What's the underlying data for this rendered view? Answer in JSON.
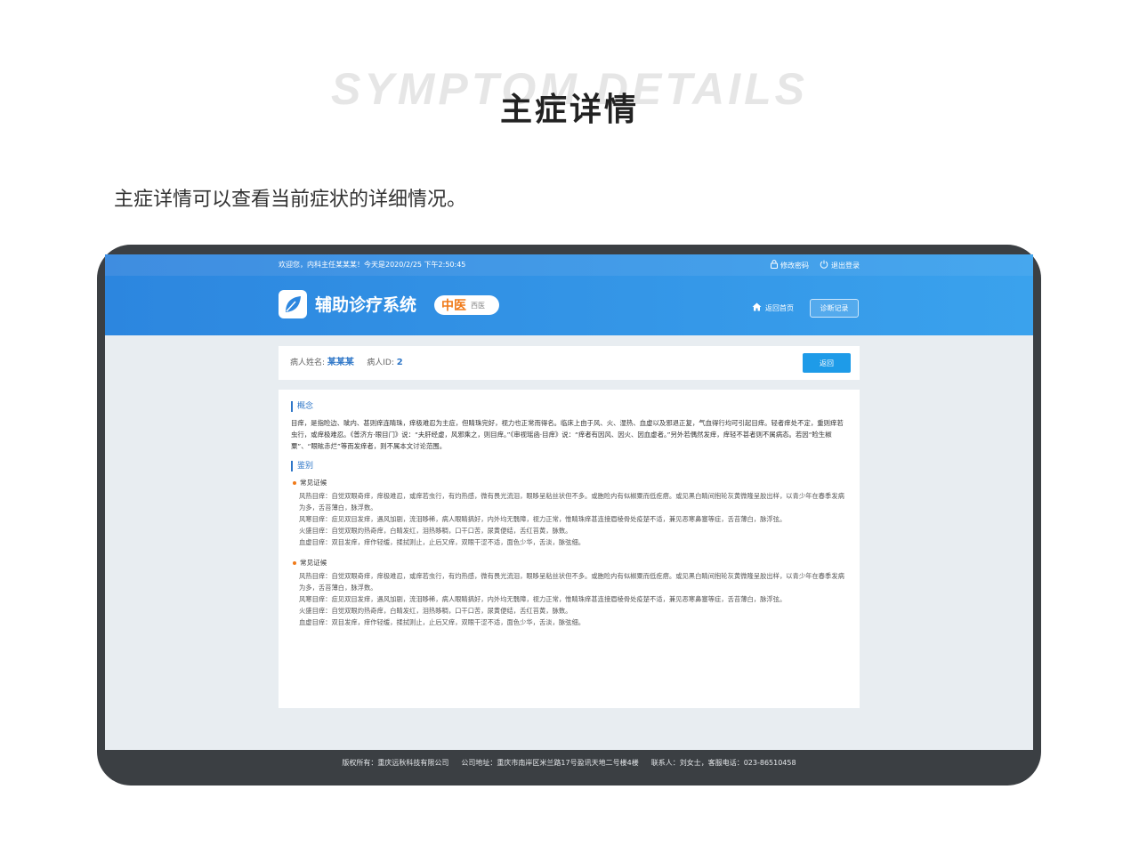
{
  "page": {
    "bg_title": "SYMPTOM DETAILS",
    "title": "主症详情",
    "intro": "主症详情可以查看当前症状的详细情况。"
  },
  "topbar": {
    "welcome": "欢迎您，内科主任某某某！今天是2020/2/25 下午2:50:45",
    "change_password": "修改密码",
    "logout": "退出登录"
  },
  "header": {
    "system_name": "辅助诊疗系统",
    "mode_active": "中医",
    "mode_other": "西医",
    "home": "返回首页",
    "records": "诊断记录"
  },
  "patient": {
    "name_label": "病人姓名:",
    "name": "某某某",
    "id_label": "病人ID:",
    "id": "2",
    "back": "返回"
  },
  "content": {
    "concept_title": "概念",
    "concept_text": "目痒，是指睑边、眦内、甚则痒连睛珠，痒极难忍为主症，但睛珠完好，视力也正常而得名。临床上由于风、火、湿热、血虚以及邪退正复，气血得行均可引起目痒。轻者痒处不定，重则痒若虫行，或痒极难忍。《普济方·眼目门》说：“夫肝经虚，风邪乘之，则目痒。”《审视瑶函·目痒》说：“痒者有因风、因火、因血虚者。”另外若偶然发痒，痒轻不甚者则不属病态。若因“睑生椒粟”、“眼眩赤烂”等而发痒者，则不属本文讨论范围。",
    "diff_title": "鉴别",
    "groups": [
      {
        "title": "常见证候",
        "lines": [
          "风热目痒：自觉双眼奇痒，痒极难忍，或痒若虫行，有灼热感，微有畏光流泪，眼眵呈粘丝状但不多。或胞睑内有似椒粟而低疙瘩。或见黑白睛间抱轮灰黄微隆呈胶出样，以青少年在春季发病为多，舌苔薄白，脉浮数。",
          "风寒目痒：症见双目发痒，遇风加剧，流泪眵稀，病人眼睛搞好，内外均无翳障，视力正常，惟睛珠痒甚连接眉棱骨处疫楚不适，兼见恶寒鼻塞等症，舌苔薄白，脉浮弦。",
          "火盛目痒：自觉双眼灼热奇痒，白睛发红，泪热眵稠，口干口苦，尿黄便结，舌红苔黄，脉数。",
          "血虚目痒：双目发痒，痒作轻缓，揉拭则止，止后又痒，双眼干涩不适，面色少华，舌淡，脉弦细。"
        ]
      },
      {
        "title": "常见证候",
        "lines": [
          "风热目痒：自觉双眼奇痒，痒极难忍，或痒若虫行，有灼热感，微有畏光流泪，眼眵呈粘丝状但不多。或胞睑内有似椒粟而低疙瘩。或见黑白睛间抱轮灰黄微隆呈胶出样，以青少年在春季发病为多，舌苔薄白，脉浮数。",
          "风寒目痒：症见双目发痒，遇风加剧，流泪眵稀，病人眼睛搞好，内外均无翳障，视力正常，惟睛珠痒甚连接眉棱骨处疫楚不适，兼见恶寒鼻塞等症，舌苔薄白，脉浮弦。",
          "火盛目痒：自觉双眼灼热奇痒，白睛发红，泪热眵稠，口干口苦，尿黄便结，舌红苔黄，脉数。",
          "血虚目痒：双目发痒，痒作轻缓，揉拭则止，止后又痒，双眼干涩不适，面色少华，舌淡，脉弦细。"
        ]
      }
    ]
  },
  "footer": {
    "copyright": "版权所有：重庆远秋科技有限公司",
    "address": "公司地址：重庆市南岸区米兰路17号盈讯天地二号楼4楼",
    "contact": "联系人：刘女士，客服电话：023-86510458"
  },
  "colors": {
    "accent": "#2c86df",
    "button": "#1e9be8",
    "mode_highlight": "#f07a19",
    "footer_bg": "#3b3f43"
  },
  "icons": {
    "lock": "lock-icon",
    "power": "power-icon",
    "logo": "leaf-logo-icon",
    "home": "home-icon",
    "bullet": "dot-icon"
  }
}
